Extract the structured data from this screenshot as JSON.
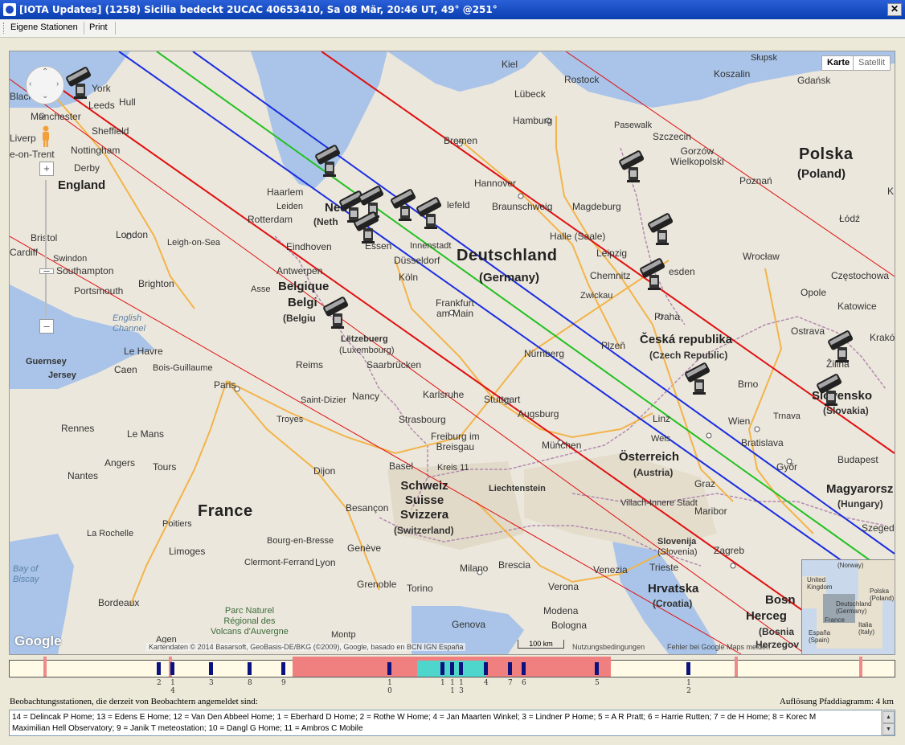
{
  "window": {
    "title": "[IOTA Updates] (1258) Sicilia bedeckt 2UCAC 40653410, Sa 08 Mär, 20:46 UT, 49° @251°",
    "close_label": "✕"
  },
  "menu": {
    "items": [
      "Eigene Stationen",
      "Print"
    ]
  },
  "map": {
    "type_buttons": [
      "Karte",
      "Satellit"
    ],
    "attribution": "Kartendaten © 2014 Basarsoft, GeoBasis-DE/BKG (©2009), Google, basado en BCN IGN España",
    "scale_label": "100 km",
    "terms_link": "Nutzungsbedingungen",
    "report_link": "Fehler bei Google Maps melden",
    "logo": "Google",
    "labels": {
      "york": "York",
      "leeds": "Leeds",
      "hull": "Hull",
      "blackpool": "Black",
      "manchester": "Manchester",
      "liverpool": "Liverp",
      "sheffield": "Sheffield",
      "stoke": "e-on-Trent",
      "nottingham": "Nottingham",
      "derby": "Derby",
      "england": "England",
      "bristol": "Bristol",
      "cardiff": "Cardiff",
      "london": "London",
      "leigh": "Leigh-on-Sea",
      "swindon": "Swindon",
      "southampton": "Southampton",
      "portsmouth": "Portsmouth",
      "brighton": "Brighton",
      "english_channel": "English\nChannel",
      "guernsey": "Guernsey",
      "jersey": "Jersey",
      "le_havre": "Le Havre",
      "caen": "Caen",
      "bois": "Bois-Guillaume",
      "reims": "Reims",
      "paris": "Paris",
      "saint_dizier": "Saint-Dizier",
      "troyes": "Troyes",
      "nancy": "Nancy",
      "rennes": "Rennes",
      "le_mans": "Le Mans",
      "angers": "Angers",
      "tours": "Tours",
      "nantes": "Nantes",
      "dijon": "Dijon",
      "france": "France",
      "besancon": "Besançon",
      "la_rochelle": "La Rochelle",
      "poitiers": "Poitiers",
      "limoges": "Limoges",
      "clermont": "Clermont-Ferrand",
      "bourg": "Bourg-en-Bresse",
      "lyon": "Lyon",
      "geneve": "Genève",
      "grenoble": "Grenoble",
      "bay_of_biscay": "Bay of\nBiscay",
      "bordeaux": "Bordeaux",
      "parc": "Parc Naturel\nRégional des\nVolcans d'Auvergne",
      "agen": "Agen",
      "montpellier": "Montp",
      "haarlem": "Haarlem",
      "leiden": "Leiden",
      "rotterdam": "Rotterdam",
      "nederland": "Ned",
      "neth": "(Neth",
      "eindhoven": "Eindhoven",
      "antwerpen": "Antwerpen",
      "asse": "Asse",
      "belgique": "Belgique",
      "belgi": "Belgi",
      "belgiu": "(Belgiu",
      "letzebuerg": "Lëtzebuerg",
      "luxembourg": "(Luxembourg)",
      "essen": "Essen",
      "duesseldorf": "Düsseldorf",
      "koeln": "Köln",
      "innenstadt": "Innenstadt",
      "bielefeld": "lefeld",
      "frankfurt": "Frankfurt\nam Main",
      "saarbruecken": "Saarbrücken",
      "karlsruhe": "Karlsruhe",
      "stuttgart": "Stuttgart",
      "strasbourg": "Strasbourg",
      "freiburg": "Freiburg im\nBreisgau",
      "basel": "Basel",
      "kreis": "Kreis 11",
      "schweiz": "Schweiz\nSuisse\nSvizzera",
      "switzerland": "(Switzerland)",
      "liechtenstein": "Liechtenstein",
      "kiel": "Kiel",
      "luebeck": "Lübeck",
      "rostock": "Rostock",
      "hamburg": "Hamburg",
      "bremen": "Bremen",
      "pasewalk": "Pasewalk",
      "szczecin": "Szczecin",
      "hannover": "Hannover",
      "braunschweig": "Braunschweig",
      "magdeburg": "Magdeburg",
      "halle": "Halle (Saale)",
      "leipzig": "Leipzig",
      "chemnitz": "Chemnitz",
      "dresden": "esden",
      "deutschland": "Deutschland",
      "germany": "(Germany)",
      "nuernberg": "Nürnberg",
      "zwickau": "Zwickau",
      "plzen": "Plzeň",
      "augsburg": "Augsburg",
      "muenchen": "München",
      "linz": "Linz",
      "wels": "Wels",
      "osterreich": "Österreich",
      "austria": "(Austria)",
      "graz": "Graz",
      "villach": "Villach-Innere Stadt",
      "maribor": "Maribor",
      "slovenija": "Slovenija",
      "slovenia": "(Slovenia)",
      "zagreb": "Zagreb",
      "trieste": "Trieste",
      "milano": "Milano",
      "brescia": "Brescia",
      "venezia": "Venezia",
      "verona": "Verona",
      "torino": "Torino",
      "genova": "Genova",
      "modena": "Modena",
      "bologna": "Bologna",
      "hrvatska": "Hrvatska",
      "croatia": "(Croatia)",
      "bosna": "Bosn",
      "herceg": "Herceg",
      "bosnia": "(Bosnia",
      "hercegov": "Herzegov",
      "koszalin": "Koszalin",
      "slupsk": "Słupsk",
      "gdansk": "Gdańsk",
      "gorzow": "Gorzów\nWielkopolski",
      "polska": "Polska",
      "poland": "(Poland)",
      "poznan": "Poznań",
      "lodz": "Łódź",
      "wroclaw": "Wrocław",
      "opole": "Opole",
      "czestochowa": "Częstochowa",
      "katowice": "Katowice",
      "krakow": "Kraków",
      "ostrava": "Ostrava",
      "praha": "Praha",
      "ceska": "Česká republika",
      "czech": "(Czech Republic)",
      "brno": "Brno",
      "zilina": "Žilina",
      "slovensko": "Slovensko",
      "slovakia": "(Slovakia)",
      "trnava": "Trnava",
      "wien": "Wien",
      "bratislava": "Bratislava",
      "gyor": "Győr",
      "budapest": "Budapest",
      "magyarorszag": "Magyarorsz",
      "hungary": "(Hungary)",
      "szeged": "Szeged",
      "kielce": "K"
    },
    "overview_labels": {
      "norway": "(Norway)",
      "uk": "United\nKingdom",
      "polska": "Polska\n(Poland)",
      "deutschland": "Deutschland\n(Germany)",
      "france": "France",
      "italia": "Italia\n(Italy)",
      "espana": "España\n(Spain)"
    }
  },
  "path_diagram": {
    "station_markers": [
      "2",
      "14",
      "3",
      "8",
      "9",
      "10",
      "1",
      "11",
      "13",
      "4",
      "7",
      "6",
      "5",
      "12"
    ]
  },
  "footer": {
    "stations_caption": "Beobachtungsstationen, die derzeit von Beobachtern angemeldet sind:",
    "resolution_caption": "Auflösung Pfaddiagramm: 4 km",
    "stations_text_line1": "14 = Delincak P Home; 13 = Edens E Home; 12 = Van Den Abbeel Home; 1 = Eberhard D Home; 2 = Rothe W Home; 4 = Jan Maarten Winkel; 3 = Lindner P Home; 5 = A R Pratt; 6 = Harrie Rutten; 7 = de H Home; 8 = Korec M",
    "stations_text_line2": "Maximilian Hell Observatory; 9 = Janik T meteostation; 10 = Dangl G Home; 11 = Ambros C Mobile"
  },
  "colors": {
    "central_line": "#22c022",
    "path_limits": "#1a2ee0",
    "error_limits": "#e01010",
    "path_band": "#f08080",
    "center_band": "#4fd6cc"
  }
}
